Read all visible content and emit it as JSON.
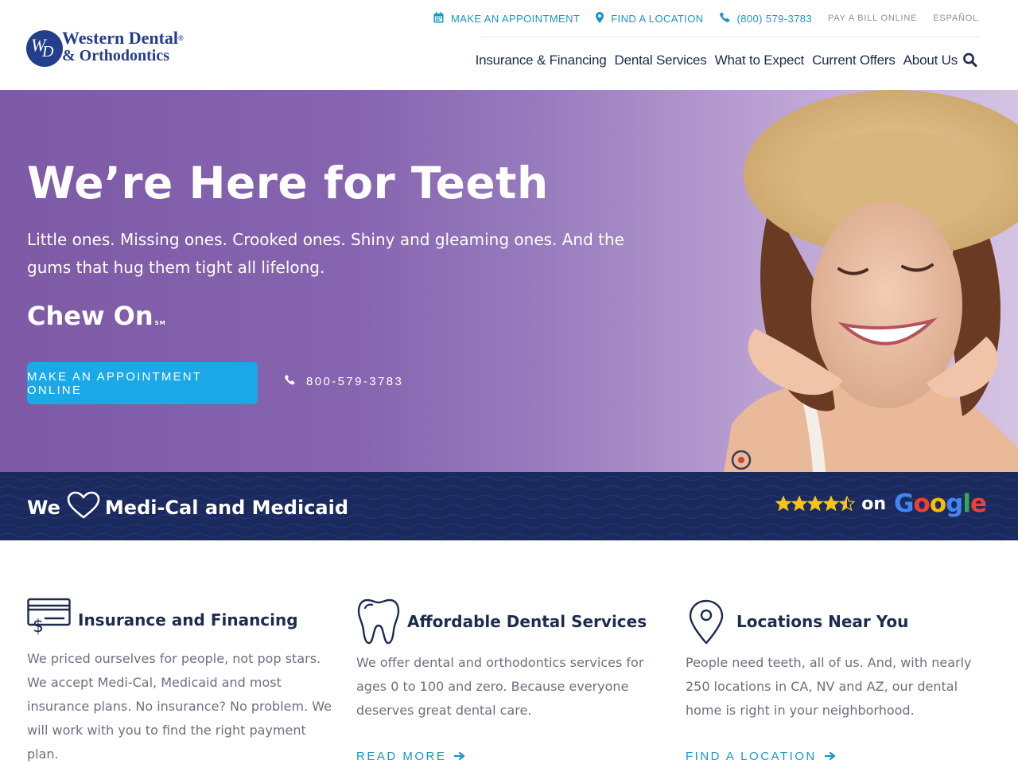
{
  "brand": {
    "mark_left": "W",
    "mark_right": "D",
    "line1": "Western Dental",
    "registered": "®",
    "line2": "& Orthodontics",
    "color": "#233e8b"
  },
  "utility_nav": {
    "appointment": "Make An Appointment",
    "location": "Find A Location",
    "phone": "(800) 579-3783",
    "pay_bill": "Pay A Bill Online",
    "language": "Español",
    "accent": "#1797c8"
  },
  "main_nav": {
    "items": [
      "Insurance & Financing",
      "Dental Services",
      "What to Expect",
      "Current Offers",
      "About Us"
    ],
    "search_icon": "search-icon"
  },
  "hero": {
    "title": "We’re Here for Teeth",
    "subtitle": "Little ones. Missing ones. Crooked ones. Shiny and gleaming ones. And the gums that hug them tight all lifelong.",
    "tagline": "Chew On",
    "tagline_mark": "SM",
    "cta": "Make An Appointment Online",
    "phone": "800-579-3783",
    "cta_color": "#1ba8e8"
  },
  "band": {
    "we": "We",
    "heart_icon": "heart-icon",
    "programs": "Medi-Cal and Medicaid",
    "rating_stars": 4.5,
    "on": "on",
    "google": [
      "G",
      "o",
      "o",
      "g",
      "l",
      "e"
    ],
    "google_colors": [
      "#4285f4",
      "#ea4335",
      "#fbbc05",
      "#4285f4",
      "#34a853",
      "#ea4335"
    ],
    "background": "#1a2a5c"
  },
  "features": [
    {
      "icon": "credit-card-icon",
      "title": "Insurance and Financing",
      "body": "We priced ourselves for people, not pop stars. We accept Medi-Cal, Medicaid and most insurance plans. No insurance? No problem. We will work with you to find the right payment plan."
    },
    {
      "icon": "tooth-icon",
      "title": "Affordable Dental Services",
      "body": "We offer dental and orthodontics services for ages 0 to 100 and zero. Because everyone deserves great dental care.",
      "link": "Read More"
    },
    {
      "icon": "location-pin-icon",
      "title": "Locations Near You",
      "body": "People need teeth, all of us. And, with nearly 250 locations in CA, NV and AZ, our dental home is right in your neighborhood.",
      "link": "Find A Location"
    }
  ]
}
